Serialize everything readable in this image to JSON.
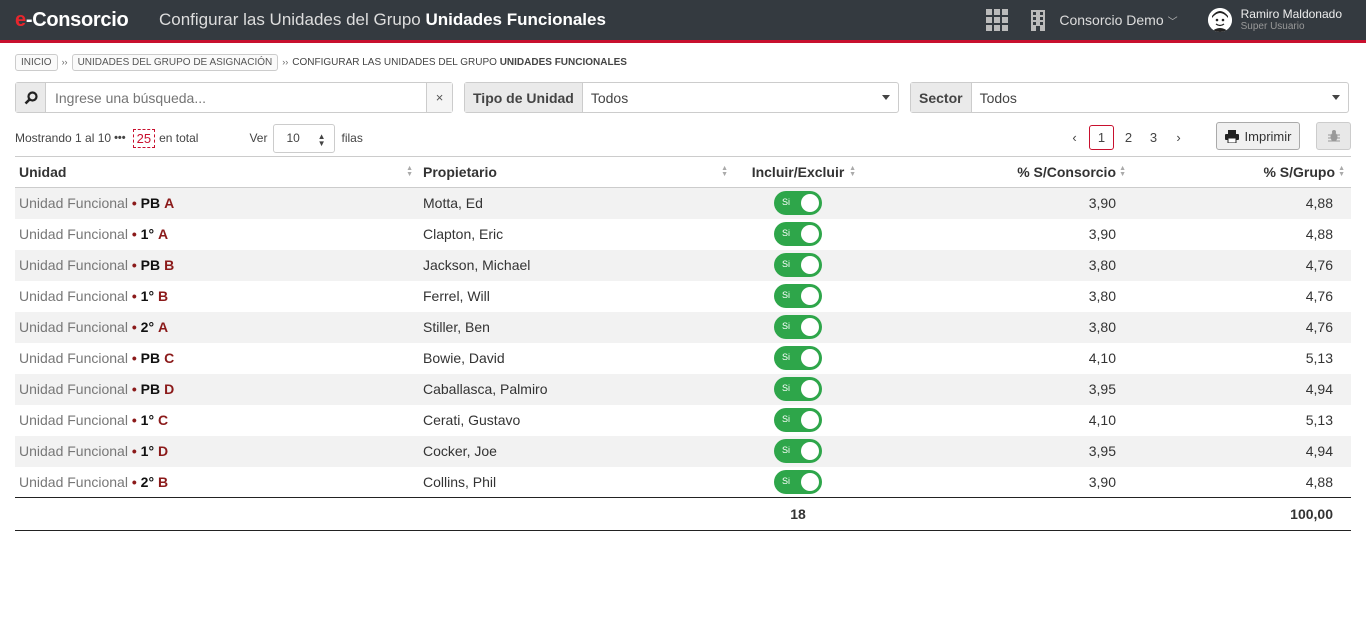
{
  "header": {
    "brand_e": "e",
    "brand_rest": "-Consorcio",
    "title_prefix": "Configurar las Unidades del Grupo",
    "title_bold": "Unidades Funcionales",
    "consorcio": "Consorcio Demo",
    "user_name": "Ramiro Maldonado",
    "user_role": "Super Usuario"
  },
  "breadcrumb": {
    "inicio": "INICIO",
    "grupo": "UNIDADES DEL GRUPO DE ASIGNACIÓN",
    "current_prefix": "CONFIGURAR LAS UNIDADES DEL GRUPO",
    "current_bold": "UNIDADES FUNCIONALES"
  },
  "filters": {
    "search_placeholder": "Ingrese una búsqueda...",
    "clear": "×",
    "tipo_label": "Tipo de Unidad",
    "tipo_value": "Todos",
    "sector_label": "Sector",
    "sector_value": "Todos"
  },
  "tools": {
    "mostrando": "Mostrando 1 al 10",
    "dots": "•••",
    "total": "25",
    "en_total": "en total",
    "ver": "Ver",
    "filas_value": "10",
    "filas": "filas",
    "pages": [
      "1",
      "2",
      "3"
    ],
    "print": "Imprimir"
  },
  "table": {
    "headers": [
      "Unidad",
      "Propietario",
      "Incluir/Excluir",
      "% S/Consorcio",
      "% S/Grupo"
    ],
    "unit_prefix": "Unidad Funcional",
    "dot": "•",
    "toggle_label": "Si",
    "rows": [
      {
        "floor": "PB",
        "letter": "A",
        "owner": "Motta, Ed",
        "consorcio": "3,90",
        "grupo": "4,88"
      },
      {
        "floor": "1°",
        "letter": "A",
        "owner": "Clapton, Eric",
        "consorcio": "3,90",
        "grupo": "4,88"
      },
      {
        "floor": "PB",
        "letter": "B",
        "owner": "Jackson, Michael",
        "consorcio": "3,80",
        "grupo": "4,76"
      },
      {
        "floor": "1°",
        "letter": "B",
        "owner": "Ferrel, Will",
        "consorcio": "3,80",
        "grupo": "4,76"
      },
      {
        "floor": "2°",
        "letter": "A",
        "owner": "Stiller, Ben",
        "consorcio": "3,80",
        "grupo": "4,76"
      },
      {
        "floor": "PB",
        "letter": "C",
        "owner": "Bowie, David",
        "consorcio": "4,10",
        "grupo": "5,13"
      },
      {
        "floor": "PB",
        "letter": "D",
        "owner": "Caballasca, Palmiro",
        "consorcio": "3,95",
        "grupo": "4,94"
      },
      {
        "floor": "1°",
        "letter": "C",
        "owner": "Cerati, Gustavo",
        "consorcio": "4,10",
        "grupo": "5,13"
      },
      {
        "floor": "1°",
        "letter": "D",
        "owner": "Cocker, Joe",
        "consorcio": "3,95",
        "grupo": "4,94"
      },
      {
        "floor": "2°",
        "letter": "B",
        "owner": "Collins, Phil",
        "consorcio": "3,90",
        "grupo": "4,88"
      }
    ],
    "footer_count": "18",
    "footer_total": "100,00"
  }
}
